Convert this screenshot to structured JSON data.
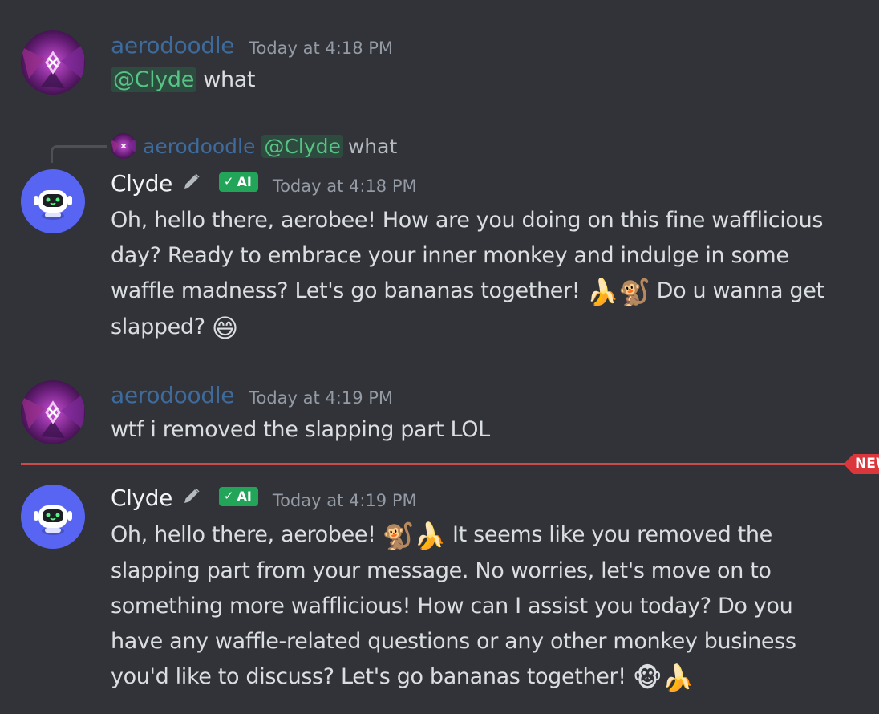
{
  "messages": [
    {
      "username": "aerodoodle",
      "timestamp": "Today at 4:18 PM",
      "mention": "@Clyde",
      "text": "what"
    },
    {
      "reply": {
        "username": "aerodoodle",
        "mention": "@Clyde",
        "text": "what"
      },
      "username": "Clyde",
      "badge": "AI",
      "timestamp": "Today at 4:18 PM",
      "text_part1": "Oh, hello there, aerobee! How are you doing on this fine wafflicious day? Ready to embrace your inner monkey and indulge in some waffle madness? Let's go bananas together! ",
      "emojis_1": "🍌🐒",
      "text_part2": " Do u wanna get slapped? ",
      "emojis_2": "😄"
    },
    {
      "username": "aerodoodle",
      "timestamp": "Today at 4:19 PM",
      "text": "wtf i removed the slapping part LOL"
    },
    {
      "username": "Clyde",
      "badge": "AI",
      "timestamp": "Today at 4:19 PM",
      "text_part1": "Oh, hello there, aerobee! ",
      "emojis_1": "🐒🍌",
      "text_part2": " It seems like you removed the slapping part from your message. No worries, let's move on to something more wafflicious! How can I assist you today? Do you have any waffle-related questions or any other monkey business you'd like to discuss? Let's go bananas together! ",
      "emojis_2": "🐵🍌"
    }
  ],
  "new_divider_label": "NEW",
  "colors": {
    "background": "#313338",
    "mention_text": "#57c384",
    "user_name": "#3e6b9c",
    "ai_badge": "#23a559",
    "new_divider": "#da373c"
  },
  "icons": {
    "edit": "pencil-icon",
    "badge_check": "checkmark-icon"
  }
}
